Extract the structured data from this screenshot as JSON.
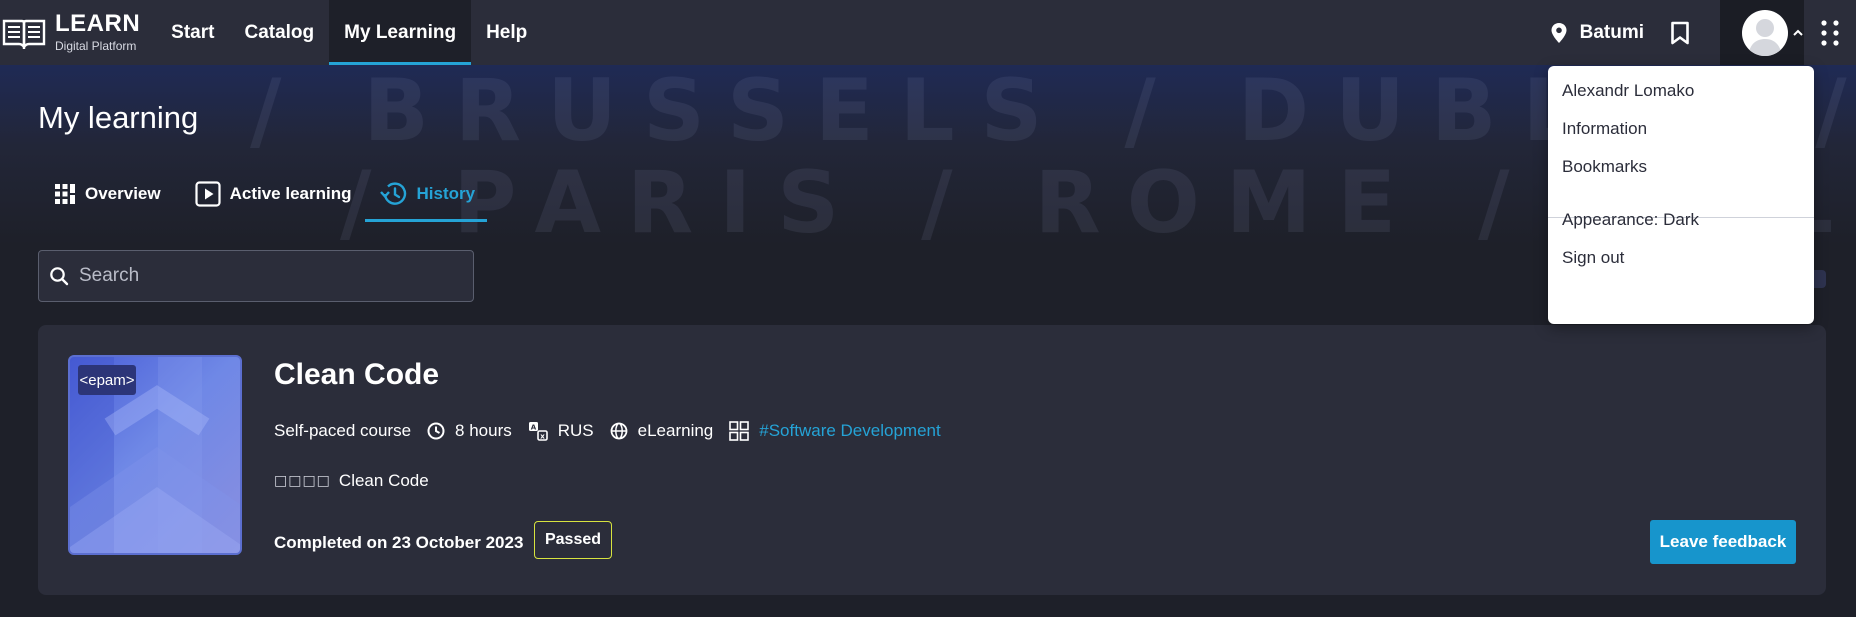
{
  "header": {
    "logo_title": "LEARN",
    "logo_subtitle": "Digital Platform",
    "nav": [
      {
        "label": "Start"
      },
      {
        "label": "Catalog"
      },
      {
        "label": "My Learning"
      },
      {
        "label": "Help"
      }
    ],
    "active_nav": "My Learning",
    "location": "Batumi"
  },
  "page": {
    "title": "My learning",
    "tabs": [
      {
        "label": "Overview"
      },
      {
        "label": "Active learning"
      },
      {
        "label": "History"
      }
    ],
    "active_tab": "History",
    "search_placeholder": "Search",
    "hero_words": [
      "/ BRUSSELS / DUBLIN / POTS",
      "/ PARIS / ROME / OSLO /"
    ]
  },
  "course": {
    "title": "Clean Code",
    "badge": "<epam>",
    "format": "Self-paced course",
    "duration": "8 hours",
    "language": "RUS",
    "delivery": "eLearning",
    "category_tag": "#Software Development",
    "description_prefix": "□□□□",
    "description": "Clean Code",
    "completed_text": "Completed on 23 October 2023",
    "status": "Passed",
    "feedback_label": "Leave feedback"
  },
  "profile_menu": {
    "user_name": "Alexandr Lomako",
    "items": [
      "Information",
      "Bookmarks"
    ],
    "appearance": "Appearance: Dark",
    "sign_out": "Sign out"
  },
  "colors": {
    "accent": "#25a3d6",
    "feedback_button": "#1795cc",
    "passed_border": "#d7e33f",
    "card_bg": "#2b2d3a",
    "page_bg": "#1e2029"
  },
  "icons": [
    "open-book-logo-icon",
    "map-pin-icon",
    "bookmark-icon",
    "user-avatar-icon",
    "chevron-up-icon",
    "apps-grid-icon",
    "overview-grid-icon",
    "play-icon",
    "history-icon",
    "search-icon",
    "clock-icon",
    "language-icon",
    "globe-icon",
    "category-grid-icon"
  ]
}
